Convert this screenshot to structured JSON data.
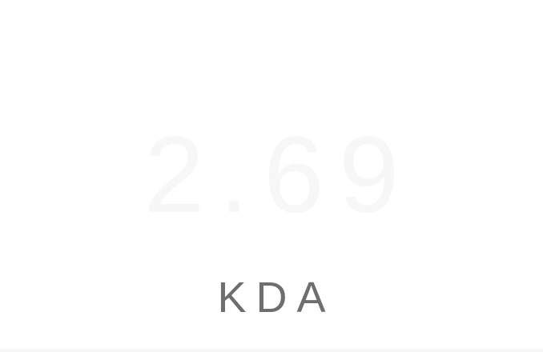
{
  "stat": {
    "value": "2.69",
    "label": "KDA"
  },
  "colors": {
    "background": "#ffffff",
    "value_text": "#f7f7f7",
    "label_text": "#6e6e6e"
  }
}
